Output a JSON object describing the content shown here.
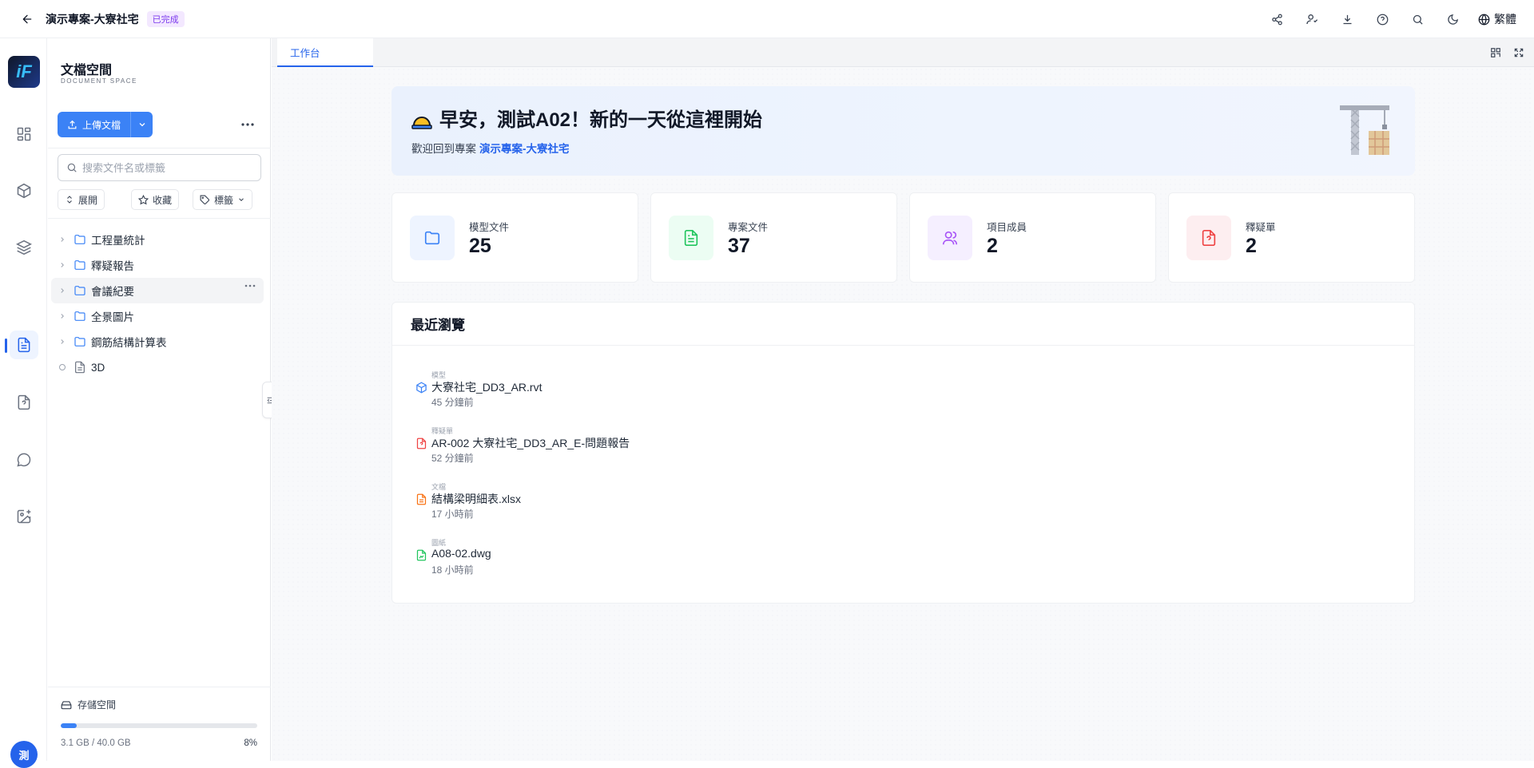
{
  "header": {
    "project_title": "演示專案-大寮社宅",
    "status": "已完成",
    "language": "繁體"
  },
  "rail": {
    "avatar_initial": "測"
  },
  "sidebar": {
    "title": "文檔空間",
    "subtitle": "DOCUMENT SPACE",
    "upload_label": "上傳文檔",
    "search_placeholder": "搜索文件名或標籤",
    "chips": {
      "expand": "展開",
      "favorite": "收藏",
      "tags": "標籤"
    },
    "tree": [
      {
        "label": "工程量統計",
        "type": "folder"
      },
      {
        "label": "釋疑報告",
        "type": "folder"
      },
      {
        "label": "會議紀要",
        "type": "folder"
      },
      {
        "label": "全景圖片",
        "type": "folder"
      },
      {
        "label": "鋼筋結構計算表",
        "type": "folder"
      },
      {
        "label": "3D",
        "type": "file"
      }
    ],
    "storage": {
      "label": "存儲空間",
      "used_text": "3.1 GB / 40.0 GB",
      "percent_text": "8%",
      "percent": 8
    }
  },
  "main": {
    "tab": "工作台",
    "hero": {
      "greeting": "早安，測試A02！新的一天從這裡開始",
      "welcome_prefix": "歡迎回到專案",
      "project_link": "演示專案-大寮社宅"
    },
    "stats": [
      {
        "label": "模型文件",
        "value": "25"
      },
      {
        "label": "專案文件",
        "value": "37"
      },
      {
        "label": "項目成員",
        "value": "2"
      },
      {
        "label": "釋疑單",
        "value": "2"
      }
    ],
    "recent": {
      "title": "最近瀏覽",
      "items": [
        {
          "type": "模型",
          "name": "大寮社宅_DD3_AR.rvt",
          "time": "45 分鐘前"
        },
        {
          "type": "釋疑單",
          "name": "AR-002 大寮社宅_DD3_AR_E-問題報告",
          "time": "52 分鐘前"
        },
        {
          "type": "文檔",
          "name": "結構梁明細表.xlsx",
          "time": "17 小時前"
        },
        {
          "type": "圖紙",
          "name": "A08-02.dwg",
          "time": "18 小時前"
        }
      ]
    }
  },
  "colors": {
    "accent": "#2563eb",
    "stat_blue_bg": "#eef4ff",
    "stat_green_bg": "#ecfdf3",
    "stat_purple_bg": "#f5efff",
    "stat_red_bg": "#fdeef0"
  }
}
